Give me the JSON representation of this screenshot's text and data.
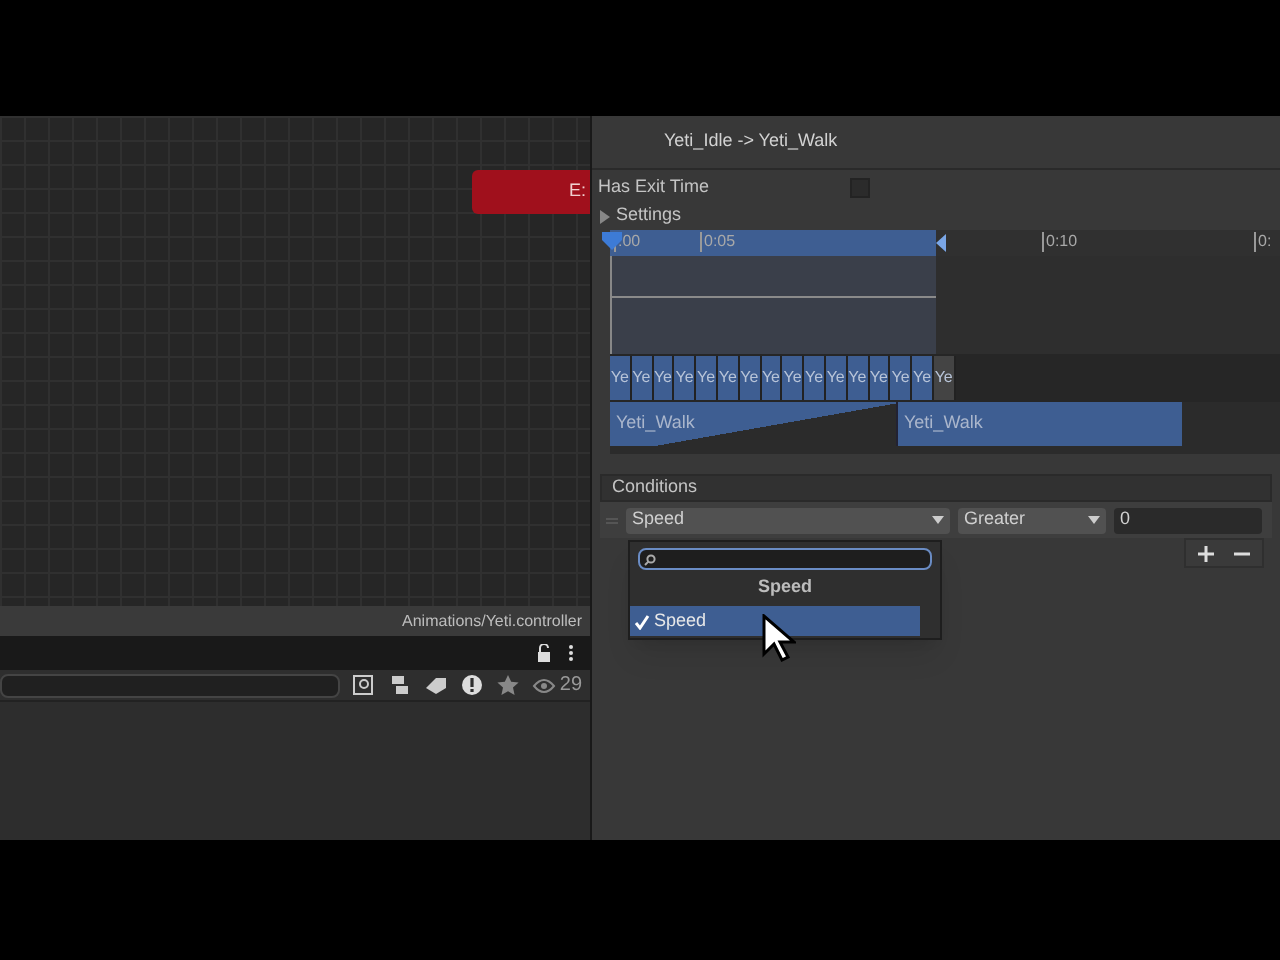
{
  "graph": {
    "node_label": "E:"
  },
  "project": {
    "path": "Animations/Yeti.controller",
    "visible_count": "29"
  },
  "inspector": {
    "title": "Yeti_Idle -> Yeti_Walk",
    "has_exit_time": {
      "label": "Has Exit Time",
      "checked": false
    },
    "settings": {
      "label": "Settings",
      "expanded": false
    },
    "timeline": {
      "ruler": [
        ":00",
        "0:05",
        "0:10",
        "0:"
      ],
      "frames": [
        "Ye",
        "Ye",
        "Ye",
        "Ye",
        "Ye",
        "Ye",
        "Ye",
        "Ye",
        "Ye",
        "Ye",
        "Ye",
        "Ye",
        "Ye",
        "Ye",
        "Ye",
        "Ye"
      ],
      "clips": [
        "Yeti_Walk",
        "Yeti_Walk"
      ]
    },
    "conditions": {
      "header": "Conditions",
      "rows": [
        {
          "parameter": "Speed",
          "mode": "Greater",
          "value": "0"
        }
      ]
    },
    "dropdown": {
      "heading": "Speed",
      "items": [
        {
          "label": "Speed",
          "selected": true
        }
      ]
    }
  }
}
